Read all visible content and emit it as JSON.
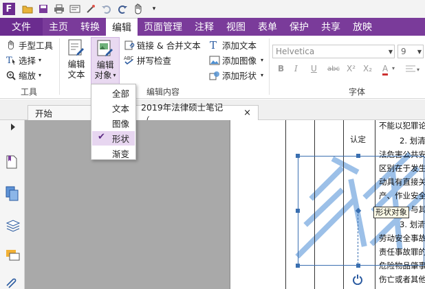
{
  "ribbon_tabs": [
    "文件",
    "主页",
    "转换",
    "编辑",
    "页面管理",
    "注释",
    "视图",
    "表单",
    "保护",
    "共享",
    "放映"
  ],
  "active_tab": "编辑",
  "tools_group": {
    "hand_tool": "手型工具",
    "select": "选择",
    "zoom": "缩放",
    "label": "工具"
  },
  "edit_group": {
    "edit_text_1": "编辑",
    "edit_text_2": "文本",
    "edit_object_1": "编辑",
    "edit_object_2": "对象",
    "link_merge": "链接 & 合并文本",
    "spell_check": "拼写检查",
    "add_text": "添加文本",
    "add_image": "添加图像",
    "add_shape": "添加形状",
    "label": "编辑内容"
  },
  "font_group": {
    "font_name": "Helvetica",
    "font_size": "9",
    "label": "字体",
    "format_buttons": [
      "B",
      "I",
      "U",
      "abc",
      "X²",
      "X₂",
      "A"
    ]
  },
  "edit_object_menu": {
    "items": [
      "全部",
      "文本",
      "图像",
      "形状",
      "渐变"
    ],
    "checked": "形状"
  },
  "doc_tabs": {
    "start": "开始",
    "document": "2019年法律硕士笔记（...",
    "close": "×"
  },
  "document": {
    "cell_label": "认定",
    "lines": [
      "不能以犯罪论",
      "2. 划清",
      "法危害公共安",
      "区别在于发生",
      "动具有直接关",
      "产、作业安全",
      "与其他",
      "3. 划清",
      "劳动安全事故",
      "责任事故罪的",
      "危险物品肇事",
      "伤亡或者其他"
    ],
    "tooltip": "形状对象"
  },
  "colors": {
    "brand": "#7a3b9a",
    "menu_checked": "#e7d6f0",
    "selection": "#3a6fb0",
    "watermark": "#9cc0e8"
  }
}
